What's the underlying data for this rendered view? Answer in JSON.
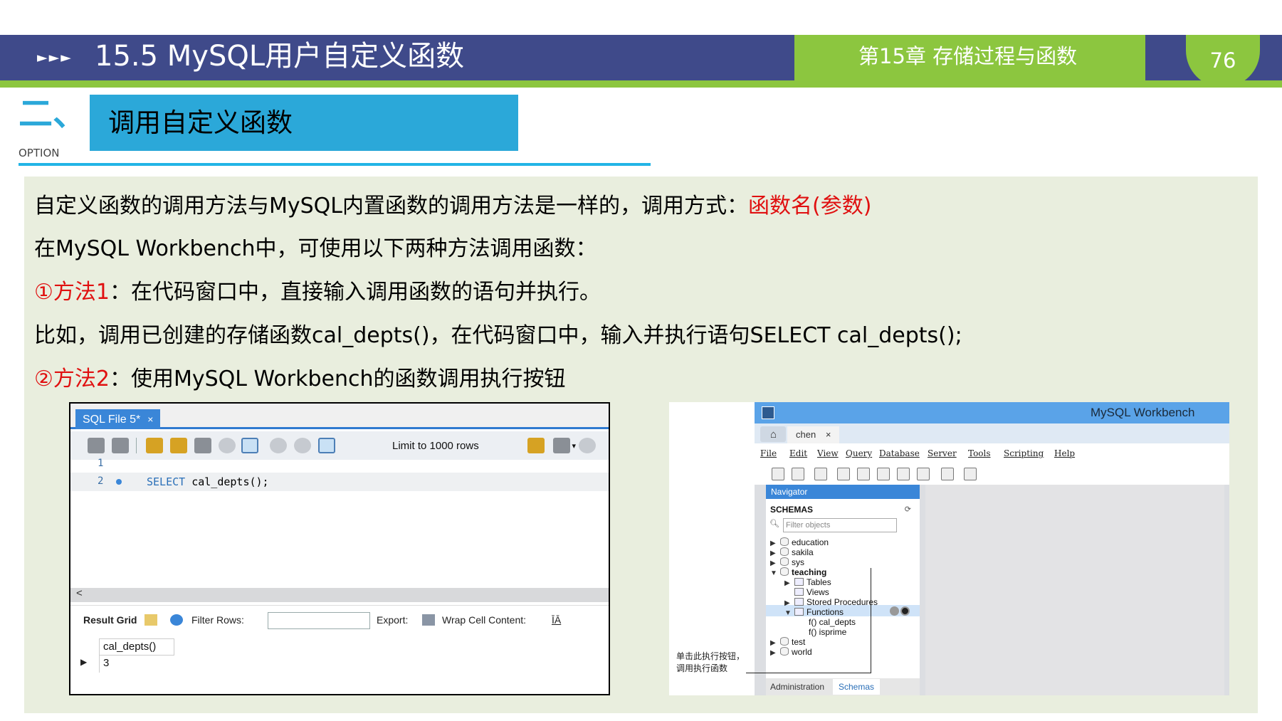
{
  "header": {
    "arrows": "►►►",
    "title": "15.5 MySQL用户自定义函数",
    "chapter": "第15章 存储过程与函数",
    "page_number": "76"
  },
  "section": {
    "number": "二、",
    "option_label": "OPTION",
    "title": "调用自定义函数"
  },
  "paragraphs": {
    "p1_text": "自定义函数的调用方法与MySQL内置函数的调用方法是一样的，调用方式：",
    "p1_highlight": "函数名(参数)",
    "p2_text": "在MySQL Workbench中，可使用以下两种方法调用函数：",
    "p3_marker": "①方法1",
    "p3_text": "：在代码窗口中，直接输入调用函数的语句并执行。",
    "p4_text": "比如，调用已创建的存储函数cal_depts()，在代码窗口中，输入并执行语句SELECT cal_depts();",
    "p5_marker": "②方法2",
    "p5_text": "：使用MySQL Workbench的函数调用执行按钮"
  },
  "sql_editor": {
    "tab_label": "SQL File 5*",
    "tab_close": "×",
    "limit_label": "Limit to 1000 rows",
    "dropdown_arrow": "▾",
    "line_numbers": [
      "1",
      "2"
    ],
    "code_keyword": "SELECT",
    "code_rest": " cal_depts();",
    "scroll_left": "<",
    "result_grid_label": "Result Grid",
    "filter_rows_label": "Filter Rows:",
    "export_label": "Export:",
    "wrap_label": "Wrap Cell Content:",
    "wrap_icon": "ĪĀ",
    "column_header": "cal_depts()",
    "row_arrow": "▶",
    "result_value": "3"
  },
  "workbench": {
    "window_title": "MySQL Workbench",
    "home_icon": "⌂",
    "connection_tab": "chen",
    "connection_close": "×",
    "menu": [
      "File",
      "Edit",
      "View",
      "Query",
      "Database",
      "Server",
      "Tools",
      "Scripting",
      "Help"
    ],
    "navigator_label": "Navigator",
    "schemas_label": "SCHEMAS",
    "filter_placeholder": "Filter objects",
    "tree": {
      "education": "education",
      "sakila": "sakila",
      "sys": "sys",
      "teaching": "teaching",
      "tables": "Tables",
      "views": "Views",
      "stored_procedures": "Stored Procedures",
      "functions": "Functions",
      "cal_depts": "f() cal_depts",
      "isprime": "f() isprime",
      "test": "test",
      "world": "world"
    },
    "bottom_tab_admin": "Administration",
    "bottom_tab_schemas": "Schemas",
    "annotation": "单击此执行按钮，调用执行函数"
  },
  "colors": {
    "header_blue": "#3f4a8a",
    "header_green": "#8cc63f",
    "section_blue": "#2ba8d9",
    "panel_bg": "#e9eede",
    "highlight_red": "#e01010"
  }
}
